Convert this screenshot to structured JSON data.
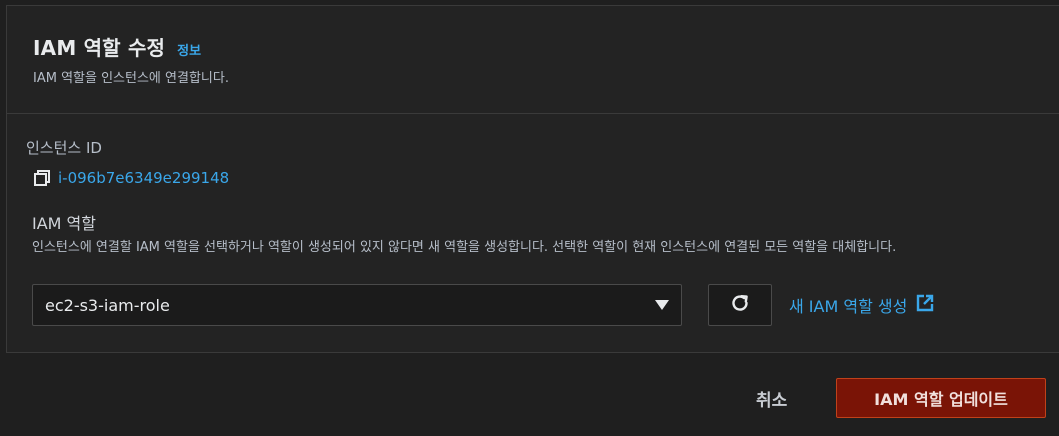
{
  "header": {
    "title": "IAM 역할 수정",
    "info_link": "정보",
    "description": "IAM 역할을 인스턴스에 연결합니다."
  },
  "instance": {
    "label": "인스턴스 ID",
    "id": "i-096b7e6349e299148",
    "copy_icon": "copy-icon"
  },
  "iam_role": {
    "label": "IAM 역할",
    "description": "인스턴스에 연결할 IAM 역할을 선택하거나 역할이 생성되어 있지 않다면 새 역할을 생성합니다. 선택한 역할이 현재 인스턴스에 연결된 모든 역할을 대체합니다.",
    "selected": "ec2-s3-iam-role",
    "refresh_icon": "refresh-icon",
    "create_link": "새 IAM 역할 생성",
    "external_icon": "external-link-icon"
  },
  "footer": {
    "cancel_label": "취소",
    "update_label": "IAM 역할 업데이트"
  },
  "colors": {
    "link": "#3aa7ea",
    "primary_button": "#7a1406",
    "primary_border": "#c0411a",
    "background": "#1f1f1f",
    "panel": "#232323"
  }
}
